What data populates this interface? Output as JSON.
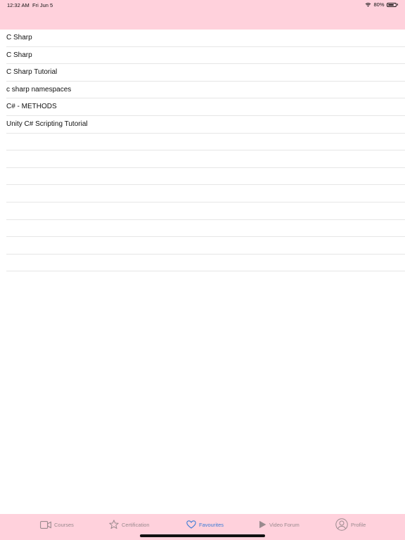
{
  "status_bar": {
    "time": "12:32 AM",
    "date": "Fri Jun 5",
    "battery": "80%",
    "battery_level": 0.8
  },
  "list": {
    "items": [
      "C Sharp",
      "C Sharp",
      "C Sharp Tutorial",
      "c sharp namespaces",
      "C# - METHODS",
      "Unity C# Scripting Tutorial",
      "",
      "",
      "",
      "",
      "",
      "",
      "",
      ""
    ]
  },
  "tabbar": {
    "courses": "Courses",
    "certification": "Certification",
    "favourites": "Favourites",
    "video_forum": "Video Forum",
    "profile": "Profile",
    "active": "favourites",
    "active_color": "#3a7bd5",
    "inactive_color": "#9a8a8e"
  },
  "colors": {
    "header_bg": "#ffd1dc",
    "tabbar_bg": "#ffd1dc"
  }
}
